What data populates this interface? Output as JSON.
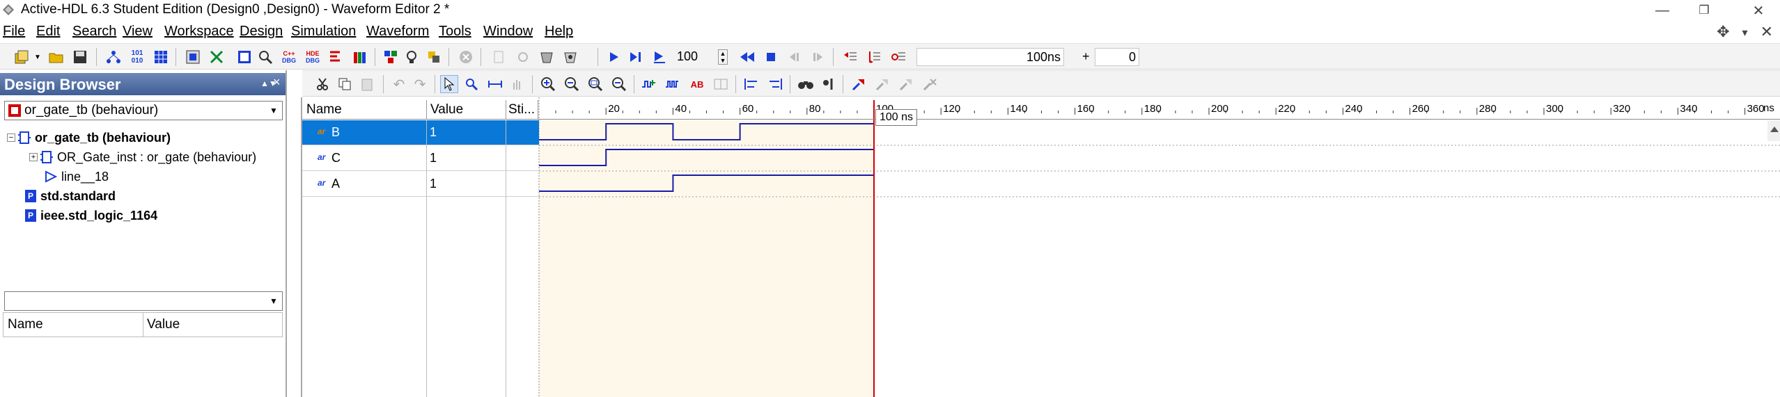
{
  "window": {
    "title": "Active-HDL 6.3 Student Edition (Design0 ,Design0) - Waveform Editor 2 *",
    "controls": [
      "—",
      "❐",
      "✕"
    ]
  },
  "menu": [
    {
      "label": "File"
    },
    {
      "label": "Edit"
    },
    {
      "label": "Search"
    },
    {
      "label": "View"
    },
    {
      "label": "Workspace"
    },
    {
      "label": "Design"
    },
    {
      "label": "Simulation"
    },
    {
      "label": "Waveform"
    },
    {
      "label": "Tools"
    },
    {
      "label": "Window"
    },
    {
      "label": "Help"
    }
  ],
  "toolbar1": {
    "step_time": "100 ns",
    "sim_time": "100ns",
    "plus_label": "+",
    "iteration": "0"
  },
  "design_browser": {
    "title": "Design Browser",
    "close": "×",
    "selected_unit": "or_gate_tb (behaviour)",
    "tree": [
      {
        "label": "or_gate_tb (behaviour)",
        "bold": true,
        "expander": "-"
      },
      {
        "label": "OR_Gate_inst : or_gate (behaviour)",
        "bold": false,
        "expander": "+"
      },
      {
        "label": "line__18",
        "bold": false
      },
      {
        "label": "std.standard",
        "bold": true,
        "icon": "P"
      },
      {
        "label": "ieee.std_logic_1164",
        "bold": true,
        "icon": "P"
      }
    ],
    "table_headers": {
      "name": "Name",
      "value": "Value"
    }
  },
  "waveform": {
    "columns": {
      "name": "Name",
      "value": "Value",
      "stimulator": "Sti..."
    },
    "signals": [
      {
        "name": "B",
        "value": "1",
        "icon": "ar",
        "selected": true
      },
      {
        "name": "C",
        "value": "1",
        "icon": "ar",
        "selected": false
      },
      {
        "name": "A",
        "value": "1",
        "icon": "ar",
        "selected": false
      }
    ],
    "time_unit_label": "ns",
    "ticks": [
      "20",
      "40",
      "60",
      "80",
      "100",
      "120",
      "140",
      "160",
      "180",
      "200",
      "220",
      "240",
      "260",
      "280",
      "300",
      "320",
      "340",
      "360"
    ],
    "cursor_label": "100 ns",
    "cursor_time": 100,
    "signal_transitions": {
      "B": [
        [
          0,
          0
        ],
        [
          20,
          1
        ],
        [
          40,
          0
        ],
        [
          60,
          1
        ],
        [
          100,
          1
        ]
      ],
      "C": [
        [
          0,
          0
        ],
        [
          20,
          1
        ],
        [
          100,
          1
        ]
      ],
      "A": [
        [
          0,
          0
        ],
        [
          40,
          1
        ],
        [
          100,
          1
        ]
      ]
    },
    "colors": {
      "wave": "#1a1aa8",
      "cursor": "#d40000",
      "sim_region": "#fdf8ea",
      "selected_row": "#0a78d7"
    }
  }
}
